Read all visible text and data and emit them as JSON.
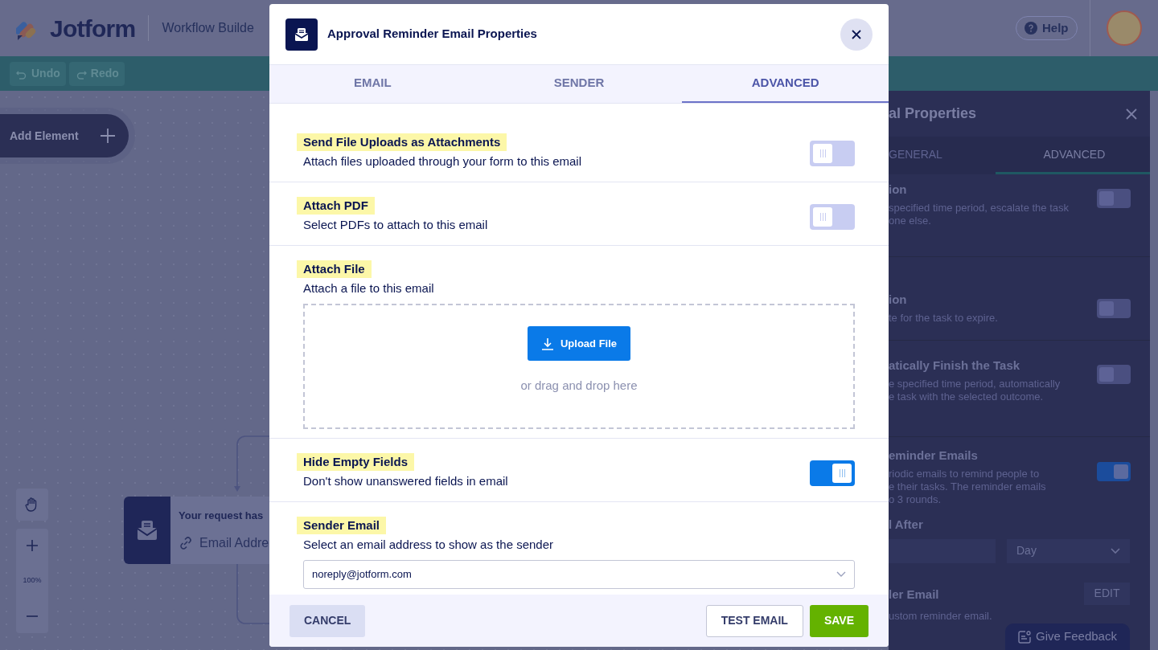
{
  "header": {
    "logo_text": "Jotform",
    "app_title": "Workflow Builde",
    "help": "Help"
  },
  "toolbar": [
    {
      "label": "Undo",
      "disabled": true
    },
    {
      "label": "Redo",
      "disabled": true
    }
  ],
  "canvas": {
    "add_element": "Add Element",
    "zoom": "100%",
    "node": {
      "title": "Your request has",
      "field": "Email Addre"
    }
  },
  "right_panel": {
    "title": "al Properties",
    "tabs": [
      {
        "label": "GENERAL",
        "selected": false
      },
      {
        "label": "ADVANCED",
        "selected": true
      }
    ],
    "settings": [
      {
        "title": "ion",
        "lines": [
          "specified time period, escalate the task",
          "one else."
        ],
        "on": false
      },
      {
        "title": "ion",
        "lines": [
          "te for the task to expire."
        ],
        "on": false
      },
      {
        "title": "atically Finish the Task",
        "lines": [
          "e specified time period, automatically",
          "e task with the selected outcome."
        ],
        "on": false
      },
      {
        "title": "eminder Emails",
        "lines": [
          "riodic emails to remind people to",
          "e their tasks. The reminder emails",
          "o 3 rounds."
        ],
        "on": true
      }
    ],
    "reminder_after": {
      "label": "l After",
      "unit": "Day"
    },
    "reminder_email": {
      "title": "ler Email",
      "description": "ustom reminder email.",
      "button": "EDIT"
    },
    "feedback": "Give Feedback"
  },
  "modal": {
    "title": "Approval Reminder Email Properties",
    "tabs": [
      {
        "label": "EMAIL",
        "selected": false
      },
      {
        "label": "SENDER",
        "selected": false
      },
      {
        "label": "ADVANCED",
        "selected": true
      }
    ],
    "settings": [
      {
        "kind": "toggle",
        "label": "Send File Uploads as Attachments",
        "description": "Attach files uploaded through your form to this email",
        "on": false
      },
      {
        "kind": "toggle",
        "label": "Attach PDF",
        "description": "Select PDFs to attach to this email",
        "on": false
      },
      {
        "kind": "upload",
        "label": "Attach File",
        "description": "Attach a file to this email",
        "button": "Upload File",
        "hint": "or drag and drop here"
      },
      {
        "kind": "toggle",
        "label": "Hide Empty Fields",
        "description": "Don't show unanswered fields in email",
        "on": true
      },
      {
        "kind": "select",
        "label": "Sender Email",
        "description": "Select an email address to show as the sender",
        "value": "noreply@jotform.com"
      }
    ],
    "buttons": {
      "cancel": "CANCEL",
      "test": "TEST EMAIL",
      "save": "SAVE"
    }
  }
}
